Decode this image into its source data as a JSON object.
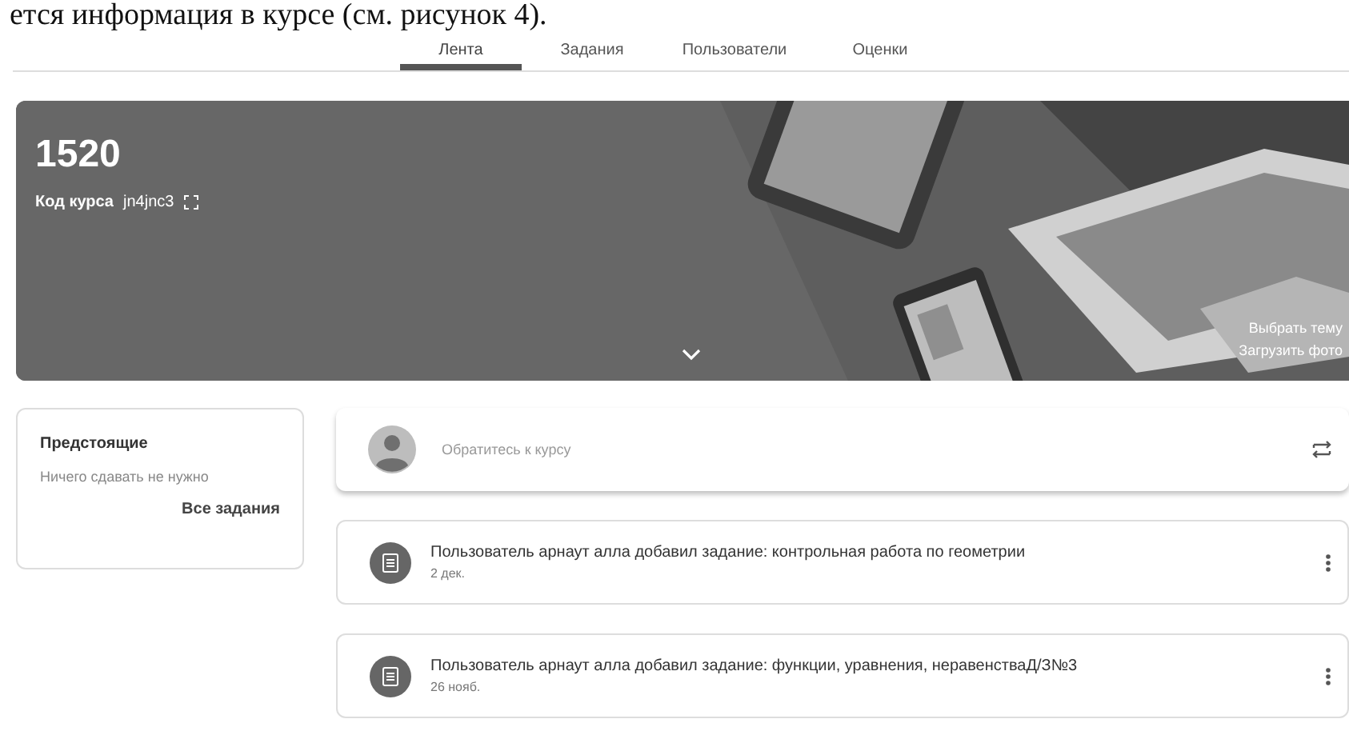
{
  "document_text": "ется информация в курсе (см. рисунок 4).",
  "tabs": [
    {
      "label": "Лента",
      "selected": true
    },
    {
      "label": "Задания",
      "selected": false
    },
    {
      "label": "Пользователи",
      "selected": false
    },
    {
      "label": "Оценки",
      "selected": false
    }
  ],
  "banner": {
    "title": "1520",
    "code_label": "Код курса",
    "code": "jn4jnc3",
    "links": [
      "Выбрать тему",
      "Загрузить фото"
    ]
  },
  "upcoming": {
    "title": "Предстоящие",
    "message": "Ничего сдавать не нужно",
    "link": "Все задания"
  },
  "share": {
    "placeholder": "Обратитесь к курсу"
  },
  "posts": [
    {
      "text": "Пользователь арнаут алла добавил задание: контрольная работа по геометрии",
      "date": "2 дек."
    },
    {
      "text": "Пользователь арнаут алла добавил задание: функции, уравнения, неравенстваД/З№3",
      "date": "26 нояб."
    }
  ]
}
